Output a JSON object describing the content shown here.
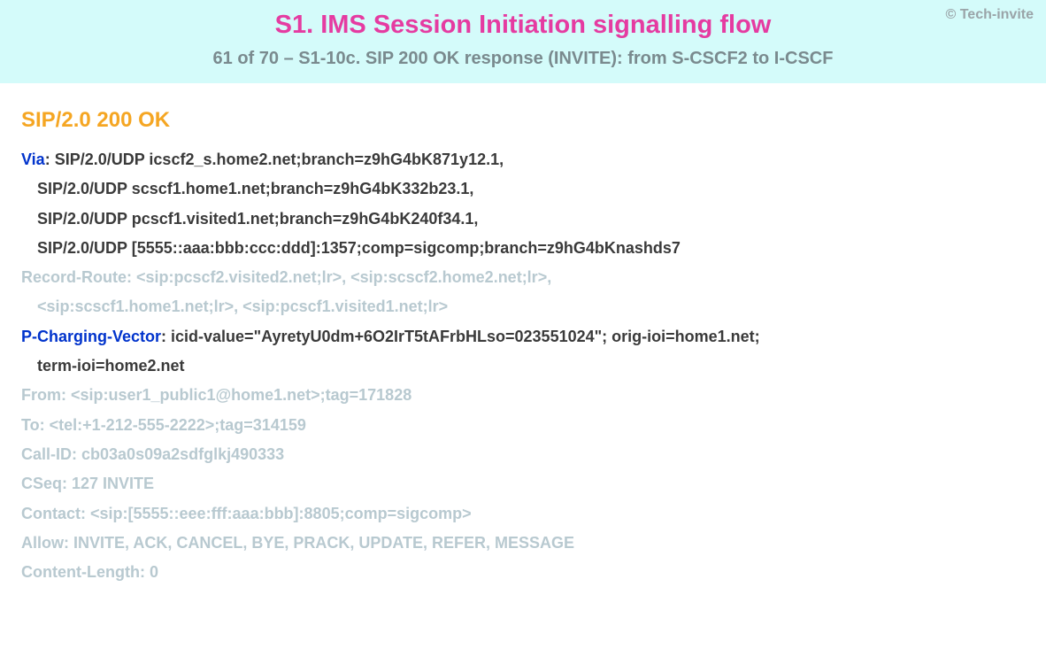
{
  "copyright": "© Tech-invite",
  "title": "S1. IMS Session Initiation signalling flow",
  "subtitle": "61 of 70 – S1-10c. SIP 200 OK response (INVITE): from S-CSCF2 to I-CSCF",
  "status_line": "SIP/2.0 200 OK",
  "headers": {
    "via": {
      "name": "Via",
      "lines": [
        "SIP/2.0/UDP icscf2_s.home2.net;branch=z9hG4bK871y12.1,",
        "SIP/2.0/UDP scscf1.home1.net;branch=z9hG4bK332b23.1,",
        "SIP/2.0/UDP pcscf1.visited1.net;branch=z9hG4bK240f34.1,",
        "SIP/2.0/UDP [5555::aaa:bbb:ccc:ddd]:1357;comp=sigcomp;branch=z9hG4bKnashds7"
      ]
    },
    "record_route": {
      "name": "Record-Route",
      "lines": [
        "<sip:pcscf2.visited2.net;lr>, <sip:scscf2.home2.net;lr>,",
        "<sip:scscf1.home1.net;lr>, <sip:pcscf1.visited1.net;lr>"
      ]
    },
    "p_charging_vector": {
      "name": "P-Charging-Vector",
      "lines": [
        "icid-value=\"AyretyU0dm+6O2IrT5tAFrbHLso=023551024\"; orig-ioi=home1.net;",
        "term-ioi=home2.net"
      ]
    },
    "from": {
      "name": "From",
      "value": "<sip:user1_public1@home1.net>;tag=171828"
    },
    "to": {
      "name": "To",
      "value": "<tel:+1-212-555-2222>;tag=314159"
    },
    "call_id": {
      "name": "Call-ID",
      "value": "cb03a0s09a2sdfglkj490333"
    },
    "cseq": {
      "name": "CSeq",
      "value": "127 INVITE"
    },
    "contact": {
      "name": "Contact",
      "value": "<sip:[5555::eee:fff:aaa:bbb]:8805;comp=sigcomp>"
    },
    "allow": {
      "name": "Allow",
      "value": "INVITE, ACK, CANCEL, BYE, PRACK, UPDATE, REFER, MESSAGE"
    },
    "content_length": {
      "name": "Content-Length",
      "value": "0"
    }
  }
}
